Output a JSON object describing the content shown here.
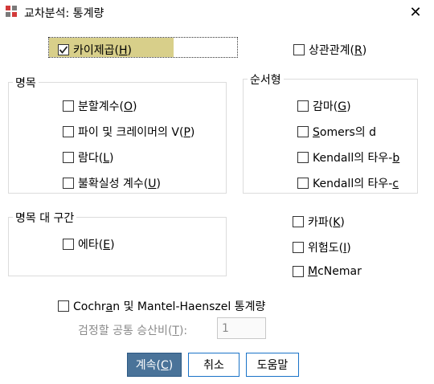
{
  "window": {
    "title": "교차분석: 통계량",
    "close_label": "✕"
  },
  "chi_square": {
    "label": "카이제곱",
    "mnemonic": "H",
    "checked": true
  },
  "correlation": {
    "label": "상관관계",
    "mnemonic": "R",
    "checked": false
  },
  "nominal": {
    "title": "명목",
    "items": [
      {
        "label": "분할계수",
        "mnemonic": "O"
      },
      {
        "label": "파이 및 크레이머의 V",
        "mnemonic": "P"
      },
      {
        "label": "람다",
        "mnemonic": "L"
      },
      {
        "label": "불확실성 계수",
        "mnemonic": "U"
      }
    ]
  },
  "ordinal": {
    "title": "순서형",
    "items": [
      {
        "label": "감마",
        "mnemonic": "G"
      },
      {
        "label_mn": "S",
        "label_rest": "omers의 d"
      },
      {
        "label": "Kendall의 타우-",
        "mnemonic": "b"
      },
      {
        "label": "Kendall의 타우-",
        "mnemonic": "c"
      }
    ]
  },
  "nominal_interval": {
    "title": "명목 대 구간",
    "items": [
      {
        "label": "에타",
        "mnemonic": "E"
      }
    ]
  },
  "kappa": {
    "label": "카파",
    "mnemonic": "K"
  },
  "risk": {
    "label": "위험도",
    "mnemonic": "I"
  },
  "mcnemar": {
    "label_mn": "M",
    "label_rest": "cNemar"
  },
  "cmh": {
    "label_pre": "Cochr",
    "label_mn": "a",
    "label_post": "n 및 Mantel-Haenszel 통계량"
  },
  "odds": {
    "label": "검정할 공통 승산비(",
    "mnemonic": "T",
    "suffix": "):",
    "value": "1"
  },
  "buttons": {
    "continue": {
      "label": "계속(",
      "mnemonic": "C",
      "suffix": ")"
    },
    "cancel": "취소",
    "help": "도움말"
  }
}
